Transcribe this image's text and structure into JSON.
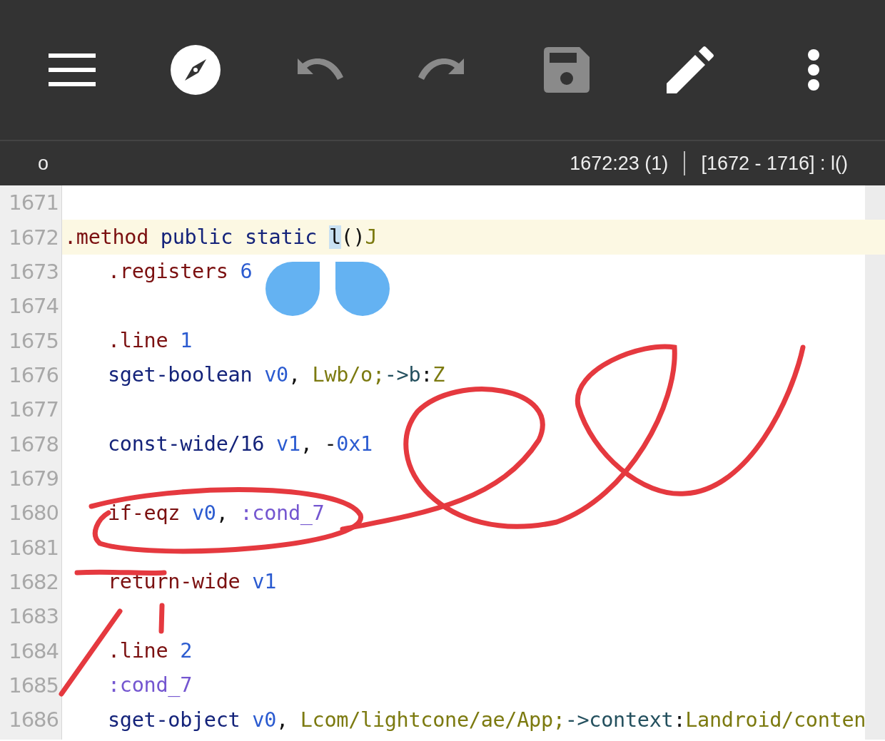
{
  "toolbar": [
    {
      "kind": "menu",
      "disabled": false
    },
    {
      "kind": "compass",
      "disabled": false
    },
    {
      "kind": "undo",
      "disabled": true
    },
    {
      "kind": "redo",
      "disabled": true
    },
    {
      "kind": "save",
      "disabled": true
    },
    {
      "kind": "pencil",
      "disabled": false
    },
    {
      "kind": "more",
      "disabled": false
    }
  ],
  "status_bar": {
    "left": "o",
    "position": "1672:23 (1)",
    "range": "[1672 - 1716] : l()"
  },
  "lines": [
    {
      "number": "1671",
      "current": false
    },
    {
      "number": "1672",
      "current": true,
      "tokens": [
        {
          "kind": "directive",
          "text": ".method"
        },
        {
          "kind": "keyword",
          "text": " public static "
        },
        {
          "kind": "cursor",
          "text": "l"
        },
        {
          "kind": "punct",
          "text": "()"
        },
        {
          "kind": "type",
          "text": "J"
        }
      ],
      "children": [
        {
          "number": "1673",
          "current": false,
          "tokens": [
            {
              "kind": "directive",
              "text": ".registers"
            },
            {
              "kind": "number",
              "text": " 6"
            }
          ]
        },
        {
          "number": "1674",
          "current": false
        },
        {
          "number": "1675",
          "current": false,
          "tokens": [
            {
              "kind": "directive",
              "text": ".line"
            },
            {
              "kind": "number",
              "text": " 1"
            }
          ]
        },
        {
          "number": "1676",
          "current": false,
          "tokens": [
            {
              "kind": "keyword",
              "text": "sget-boolean"
            },
            {
              "kind": "number",
              "text": " v0"
            },
            {
              "kind": "punct",
              "text": ", "
            },
            {
              "kind": "type",
              "text": "Lwb/o;"
            },
            {
              "kind": "arrow",
              "text": "->b"
            },
            {
              "kind": "punct",
              "text": ":"
            },
            {
              "kind": "type",
              "text": "Z"
            }
          ]
        },
        {
          "number": "1677",
          "current": false
        },
        {
          "number": "1678",
          "current": false,
          "tokens": [
            {
              "kind": "keyword",
              "text": "const-wide/16"
            },
            {
              "kind": "number",
              "text": " v1"
            },
            {
              "kind": "punct",
              "text": ", -"
            },
            {
              "kind": "number",
              "text": "0x1"
            }
          ]
        },
        {
          "number": "1679",
          "current": false
        },
        {
          "number": "1680",
          "current": false,
          "tokens": [
            {
              "kind": "directive",
              "text": "if-eqz"
            },
            {
              "kind": "number",
              "text": " v0"
            },
            {
              "kind": "punct",
              "text": ", "
            },
            {
              "kind": "label",
              "text": ":cond_7"
            }
          ]
        },
        {
          "number": "1681",
          "current": false
        },
        {
          "number": "1682",
          "current": false,
          "tokens": [
            {
              "kind": "directive",
              "text": "return-wide"
            },
            {
              "kind": "number",
              "text": " v1"
            }
          ]
        },
        {
          "number": "1683",
          "current": false
        },
        {
          "number": "1684",
          "current": false,
          "tokens": [
            {
              "kind": "directive",
              "text": ".line"
            },
            {
              "kind": "number",
              "text": " 2"
            }
          ]
        },
        {
          "number": "1685",
          "current": false,
          "tokens": [
            {
              "kind": "label",
              "text": ":cond_7"
            }
          ]
        },
        {
          "number": "1686",
          "current": false,
          "tokens": [
            {
              "kind": "keyword",
              "text": "sget-object"
            },
            {
              "kind": "number",
              "text": " v0"
            },
            {
              "kind": "punct",
              "text": ", "
            },
            {
              "kind": "type",
              "text": "Lcom/lightcone/ae/App;"
            },
            {
              "kind": "arrow",
              "text": "->context"
            },
            {
              "kind": "punct",
              "text": ":"
            },
            {
              "kind": "type",
              "text": "Landroid/conten"
            }
          ]
        }
      ]
    }
  ]
}
